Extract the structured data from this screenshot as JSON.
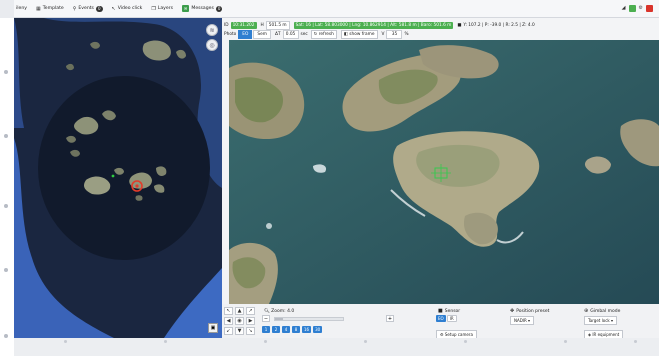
{
  "toolbar": {
    "menu_label": "ileny",
    "template_label": "Template",
    "events_label": "Events",
    "events_count": "0",
    "video_click_label": "Video click",
    "layers_label": "Layers",
    "messages_label": "Messages",
    "messages_count": "0"
  },
  "telemetry": {
    "id_label": "ID",
    "id_value": "10:31.202",
    "hfrom_label": "H",
    "hfrom_value": "501.5 m",
    "gps_text": "Sat: 16 | Lat: 58.803000 | Lng: 10.862914 | Alt: 581.8 m | Baro: 501.6 m",
    "attitude_text": "Y: 107.2 | P: -39.0 | R: 2.5 | Z: 4.0"
  },
  "view": {
    "mode_label": "Photo",
    "mode_options": [
      "EO",
      "Sem"
    ],
    "delta_label": "ΔT",
    "delta_value": "0.05",
    "sec_label": "sec",
    "refresh_label": "refresh",
    "showframe_label": "show frame",
    "vgimbal_label": "V",
    "vgimbal_value": "35",
    "percent_label": "%"
  },
  "camera": {
    "zoom_label": "Zoom: 4.0",
    "zoom_level": 0.12,
    "zoom_presets": [
      "1",
      "2",
      "4",
      "8",
      "16",
      "30"
    ],
    "sensor_title": "Sensor",
    "sensor_options": [
      "EO",
      "IR"
    ],
    "setup_camera_label": "Setup camera",
    "position_preset_title": "Position preset",
    "position_preset_value": "NADIR",
    "gimbal_mode_title": "Gimbal mode",
    "gimbal_mode_value": "Target lock",
    "ir_equipment_label": "IR equipment"
  },
  "colors": {
    "accent": "#2f7fd1",
    "status_green": "#4caf50",
    "map_water": "#1d2a44",
    "sea": "#2f5a5e"
  }
}
